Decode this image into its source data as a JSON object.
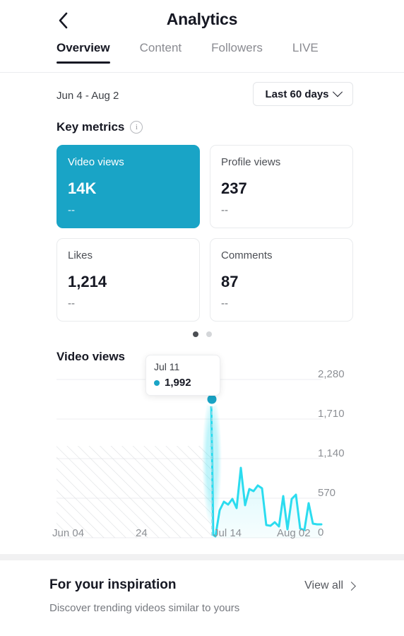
{
  "header": {
    "title": "Analytics",
    "back_icon": "chevron-left-icon"
  },
  "tabs": [
    {
      "label": "Overview",
      "active": true
    },
    {
      "label": "Content",
      "active": false
    },
    {
      "label": "Followers",
      "active": false
    },
    {
      "label": "LIVE",
      "active": false
    }
  ],
  "date_row": {
    "range_text": "Jun 4 - Aug 2",
    "selector_label": "Last 60 days",
    "selector_icon": "chevron-down-icon"
  },
  "key_metrics": {
    "heading": "Key metrics",
    "info_icon": "info-icon",
    "info_glyph": "i",
    "cards": [
      {
        "label": "Video views",
        "value": "14K",
        "delta": "--",
        "selected": true
      },
      {
        "label": "Profile views",
        "value": "237",
        "delta": "--",
        "selected": false
      },
      {
        "label": "Likes",
        "value": "1,214",
        "delta": "--",
        "selected": false
      },
      {
        "label": "Comments",
        "value": "87",
        "delta": "--",
        "selected": false
      }
    ],
    "pager": {
      "total": 2,
      "active_index": 0
    }
  },
  "chart_data": {
    "type": "area",
    "title": "Video views",
    "xlabel": "",
    "ylabel": "",
    "grid": true,
    "legend": "none",
    "accent_color": "#19A4C6",
    "line_color": "#2BDCEF",
    "ylim": [
      0,
      2280
    ],
    "yticks": [
      "0",
      "570",
      "1,140",
      "1,710",
      "2,280"
    ],
    "ytick_values": [
      0,
      570,
      1140,
      1710,
      2280
    ],
    "xticks": [
      "Jun 04",
      "24",
      "Jul 14",
      "Aug 02"
    ],
    "xtick_values": [
      0,
      20,
      40,
      59
    ],
    "no_data_region": {
      "from_index": 0,
      "to_index": 36,
      "style": "diagonal-hatch"
    },
    "highlight": {
      "date": "Jul 11",
      "value": 1992,
      "index": 37
    },
    "values": [
      null,
      null,
      null,
      null,
      null,
      null,
      null,
      null,
      null,
      null,
      null,
      null,
      null,
      null,
      null,
      null,
      null,
      null,
      null,
      null,
      null,
      null,
      null,
      null,
      null,
      null,
      null,
      null,
      null,
      null,
      null,
      null,
      null,
      null,
      null,
      null,
      null,
      1992,
      40,
      20,
      390,
      520,
      480,
      560,
      430,
      1010,
      470,
      700,
      670,
      760,
      720,
      180,
      170,
      220,
      160,
      600,
      120,
      560,
      620,
      130,
      110,
      500,
      200
    ]
  },
  "tooltip": {
    "date": "Jul 11",
    "value": "1,992",
    "bullet_color": "#19A4C6"
  },
  "inspiration": {
    "title": "For your inspiration",
    "view_all_label": "View all",
    "view_all_icon": "chevron-right-icon",
    "subtitle": "Discover trending videos similar to yours"
  }
}
